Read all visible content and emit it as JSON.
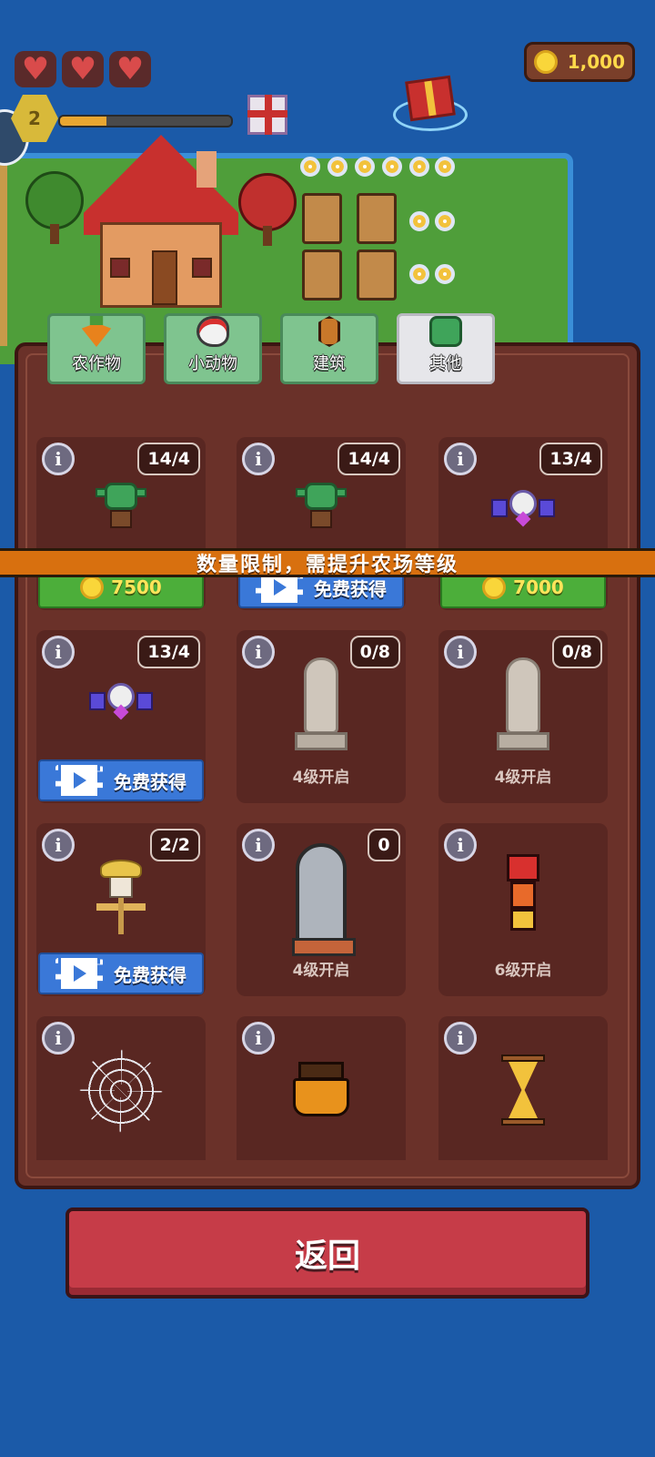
{
  "hud": {
    "coins": "1,000",
    "level": "2",
    "xp_progress": 0.27
  },
  "tabs": [
    {
      "label": "农作物",
      "icon": "carrot-icon",
      "active": false
    },
    {
      "label": "小动物",
      "icon": "chicken-icon",
      "active": false
    },
    {
      "label": "建筑",
      "icon": "crystal-icon",
      "active": false
    },
    {
      "label": "其他",
      "icon": "goblin-icon",
      "active": true
    }
  ],
  "banner": "数量限制，需提升农场等级",
  "items": [
    {
      "art": "goblin-icon",
      "count": "14/4",
      "action": "buy",
      "price": "7500"
    },
    {
      "art": "goblin-icon",
      "count": "14/4",
      "action": "video",
      "label": "免费获得"
    },
    {
      "art": "robot-drone-icon",
      "count": "13/4",
      "action": "buy",
      "price": "7000"
    },
    {
      "art": "robot-drone-icon",
      "count": "13/4",
      "action": "video",
      "label": "免费获得"
    },
    {
      "art": "statue-icon",
      "count": "0/8",
      "action": "locked",
      "label": "4级开启"
    },
    {
      "art": "statue-icon",
      "count": "0/8",
      "action": "locked",
      "label": "4级开启"
    },
    {
      "art": "scarecrow-icon",
      "count": "2/2",
      "action": "video",
      "label": "免费获得"
    },
    {
      "art": "tombstone-icon",
      "count": "0",
      "action": "locked",
      "label": "4级开启"
    },
    {
      "art": "firefighter-icon",
      "count": "",
      "action": "locked",
      "label": "6级开启"
    },
    {
      "art": "spider-web-icon",
      "count": "",
      "action": "locked",
      "label": ""
    },
    {
      "art": "cauldron-icon",
      "count": "",
      "action": "locked",
      "label": ""
    },
    {
      "art": "hourglass-icon",
      "count": "",
      "action": "locked",
      "label": ""
    }
  ],
  "back_button": "返回",
  "info_glyph": "i"
}
